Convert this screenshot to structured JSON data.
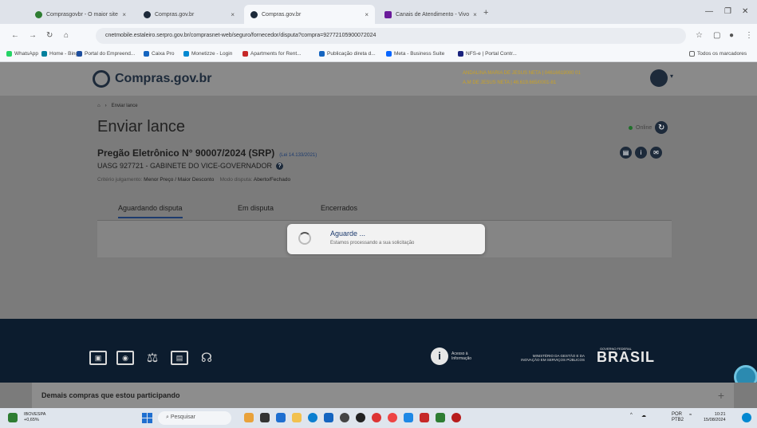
{
  "browser": {
    "tabs": [
      {
        "label": "Comprasgovbr - O maior site"
      },
      {
        "label": "Compras.gov.br"
      },
      {
        "label": "Compras.gov.br"
      },
      {
        "label": "Canais de Atendimento - Vivo"
      }
    ],
    "url": "cnetmobile.estaleiro.serpro.gov.br/comprasnet-web/seguro/fornecedor/disputa?compra=92772105900072024",
    "bookmarks": [
      "WhatsApp",
      "Home - Bing",
      "Portal do Empreend...",
      "Caixa Pro",
      "Monetizze - Login",
      "Apartments for Rent...",
      "Publicação direta d...",
      "Meta - Business Suite",
      "NFS-e | Portal Contr..."
    ],
    "bookmarks_right": "Todos os marcadores"
  },
  "header": {
    "logo": "Compras.gov.br",
    "user_line1": "ANDALINA MARIA DE JESUS NETA | 04616619000 01",
    "user_line2": "A.M DE JESUS NETA | 46.619.665/0001-81"
  },
  "page": {
    "breadcrumb": "Enviar lance",
    "title": "Enviar lance",
    "online": "Online",
    "pregao": "Pregão Eletrônico N° 90007/2024 (SRP)",
    "lei": "(Lei 14.133/2021)",
    "uasg": "UASG 927721 - GABINETE DO VICE-GOVERNADOR",
    "criterio_label": "Critério julgamento:",
    "criterio_value": "Menor Preço / Maior Desconto",
    "modo_label": "Modo disputa:",
    "modo_value": "Aberto/Fechado",
    "tabs": [
      "Aguardando disputa",
      "Em disputa",
      "Encerrados"
    ]
  },
  "modal": {
    "title": "Aguarde ...",
    "subtitle": "Estamos processando a sua solicitação"
  },
  "footer": {
    "info_label": "Acesso à Informação",
    "ministry": "MINISTÉRIO DA GESTÃO E DA INOVAÇÃO EM SERVIÇOS PÚBLICOS",
    "brasil": "BRASIL",
    "gov_federal": "GOVERNO FEDERAL",
    "demais": "Demais compras que estou participando",
    "plus": "+"
  },
  "taskbar": {
    "weather_name": "IBOVESPA",
    "weather_value": "+0,65%",
    "search": "Pesquisar",
    "lang_line1": "POR",
    "lang_line2": "PTB2",
    "time": "10:21",
    "date": "15/08/2024"
  }
}
